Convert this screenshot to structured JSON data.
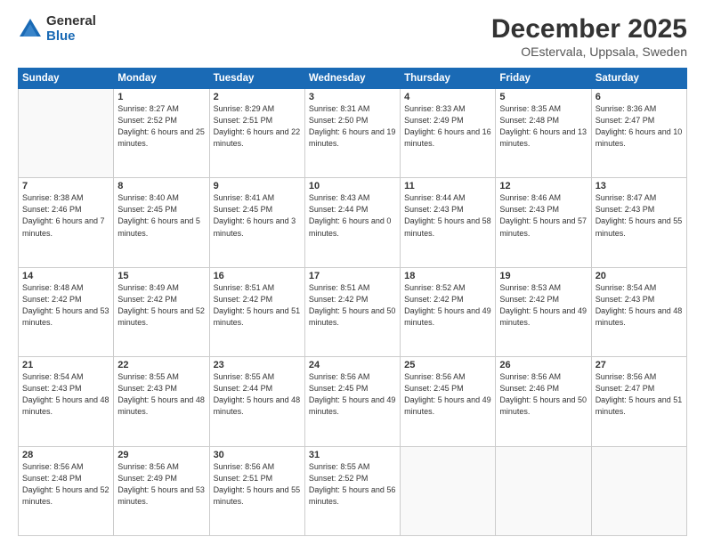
{
  "logo": {
    "general": "General",
    "blue": "Blue"
  },
  "header": {
    "month": "December 2025",
    "location": "OEstervala, Uppsala, Sweden"
  },
  "weekdays": [
    "Sunday",
    "Monday",
    "Tuesday",
    "Wednesday",
    "Thursday",
    "Friday",
    "Saturday"
  ],
  "weeks": [
    [
      {
        "day": "",
        "sunrise": "",
        "sunset": "",
        "daylight": ""
      },
      {
        "day": "1",
        "sunrise": "Sunrise: 8:27 AM",
        "sunset": "Sunset: 2:52 PM",
        "daylight": "Daylight: 6 hours and 25 minutes."
      },
      {
        "day": "2",
        "sunrise": "Sunrise: 8:29 AM",
        "sunset": "Sunset: 2:51 PM",
        "daylight": "Daylight: 6 hours and 22 minutes."
      },
      {
        "day": "3",
        "sunrise": "Sunrise: 8:31 AM",
        "sunset": "Sunset: 2:50 PM",
        "daylight": "Daylight: 6 hours and 19 minutes."
      },
      {
        "day": "4",
        "sunrise": "Sunrise: 8:33 AM",
        "sunset": "Sunset: 2:49 PM",
        "daylight": "Daylight: 6 hours and 16 minutes."
      },
      {
        "day": "5",
        "sunrise": "Sunrise: 8:35 AM",
        "sunset": "Sunset: 2:48 PM",
        "daylight": "Daylight: 6 hours and 13 minutes."
      },
      {
        "day": "6",
        "sunrise": "Sunrise: 8:36 AM",
        "sunset": "Sunset: 2:47 PM",
        "daylight": "Daylight: 6 hours and 10 minutes."
      }
    ],
    [
      {
        "day": "7",
        "sunrise": "Sunrise: 8:38 AM",
        "sunset": "Sunset: 2:46 PM",
        "daylight": "Daylight: 6 hours and 7 minutes."
      },
      {
        "day": "8",
        "sunrise": "Sunrise: 8:40 AM",
        "sunset": "Sunset: 2:45 PM",
        "daylight": "Daylight: 6 hours and 5 minutes."
      },
      {
        "day": "9",
        "sunrise": "Sunrise: 8:41 AM",
        "sunset": "Sunset: 2:45 PM",
        "daylight": "Daylight: 6 hours and 3 minutes."
      },
      {
        "day": "10",
        "sunrise": "Sunrise: 8:43 AM",
        "sunset": "Sunset: 2:44 PM",
        "daylight": "Daylight: 6 hours and 0 minutes."
      },
      {
        "day": "11",
        "sunrise": "Sunrise: 8:44 AM",
        "sunset": "Sunset: 2:43 PM",
        "daylight": "Daylight: 5 hours and 58 minutes."
      },
      {
        "day": "12",
        "sunrise": "Sunrise: 8:46 AM",
        "sunset": "Sunset: 2:43 PM",
        "daylight": "Daylight: 5 hours and 57 minutes."
      },
      {
        "day": "13",
        "sunrise": "Sunrise: 8:47 AM",
        "sunset": "Sunset: 2:43 PM",
        "daylight": "Daylight: 5 hours and 55 minutes."
      }
    ],
    [
      {
        "day": "14",
        "sunrise": "Sunrise: 8:48 AM",
        "sunset": "Sunset: 2:42 PM",
        "daylight": "Daylight: 5 hours and 53 minutes."
      },
      {
        "day": "15",
        "sunrise": "Sunrise: 8:49 AM",
        "sunset": "Sunset: 2:42 PM",
        "daylight": "Daylight: 5 hours and 52 minutes."
      },
      {
        "day": "16",
        "sunrise": "Sunrise: 8:51 AM",
        "sunset": "Sunset: 2:42 PM",
        "daylight": "Daylight: 5 hours and 51 minutes."
      },
      {
        "day": "17",
        "sunrise": "Sunrise: 8:51 AM",
        "sunset": "Sunset: 2:42 PM",
        "daylight": "Daylight: 5 hours and 50 minutes."
      },
      {
        "day": "18",
        "sunrise": "Sunrise: 8:52 AM",
        "sunset": "Sunset: 2:42 PM",
        "daylight": "Daylight: 5 hours and 49 minutes."
      },
      {
        "day": "19",
        "sunrise": "Sunrise: 8:53 AM",
        "sunset": "Sunset: 2:42 PM",
        "daylight": "Daylight: 5 hours and 49 minutes."
      },
      {
        "day": "20",
        "sunrise": "Sunrise: 8:54 AM",
        "sunset": "Sunset: 2:43 PM",
        "daylight": "Daylight: 5 hours and 48 minutes."
      }
    ],
    [
      {
        "day": "21",
        "sunrise": "Sunrise: 8:54 AM",
        "sunset": "Sunset: 2:43 PM",
        "daylight": "Daylight: 5 hours and 48 minutes."
      },
      {
        "day": "22",
        "sunrise": "Sunrise: 8:55 AM",
        "sunset": "Sunset: 2:43 PM",
        "daylight": "Daylight: 5 hours and 48 minutes."
      },
      {
        "day": "23",
        "sunrise": "Sunrise: 8:55 AM",
        "sunset": "Sunset: 2:44 PM",
        "daylight": "Daylight: 5 hours and 48 minutes."
      },
      {
        "day": "24",
        "sunrise": "Sunrise: 8:56 AM",
        "sunset": "Sunset: 2:45 PM",
        "daylight": "Daylight: 5 hours and 49 minutes."
      },
      {
        "day": "25",
        "sunrise": "Sunrise: 8:56 AM",
        "sunset": "Sunset: 2:45 PM",
        "daylight": "Daylight: 5 hours and 49 minutes."
      },
      {
        "day": "26",
        "sunrise": "Sunrise: 8:56 AM",
        "sunset": "Sunset: 2:46 PM",
        "daylight": "Daylight: 5 hours and 50 minutes."
      },
      {
        "day": "27",
        "sunrise": "Sunrise: 8:56 AM",
        "sunset": "Sunset: 2:47 PM",
        "daylight": "Daylight: 5 hours and 51 minutes."
      }
    ],
    [
      {
        "day": "28",
        "sunrise": "Sunrise: 8:56 AM",
        "sunset": "Sunset: 2:48 PM",
        "daylight": "Daylight: 5 hours and 52 minutes."
      },
      {
        "day": "29",
        "sunrise": "Sunrise: 8:56 AM",
        "sunset": "Sunset: 2:49 PM",
        "daylight": "Daylight: 5 hours and 53 minutes."
      },
      {
        "day": "30",
        "sunrise": "Sunrise: 8:56 AM",
        "sunset": "Sunset: 2:51 PM",
        "daylight": "Daylight: 5 hours and 55 minutes."
      },
      {
        "day": "31",
        "sunrise": "Sunrise: 8:55 AM",
        "sunset": "Sunset: 2:52 PM",
        "daylight": "Daylight: 5 hours and 56 minutes."
      },
      {
        "day": "",
        "sunrise": "",
        "sunset": "",
        "daylight": ""
      },
      {
        "day": "",
        "sunrise": "",
        "sunset": "",
        "daylight": ""
      },
      {
        "day": "",
        "sunrise": "",
        "sunset": "",
        "daylight": ""
      }
    ]
  ]
}
